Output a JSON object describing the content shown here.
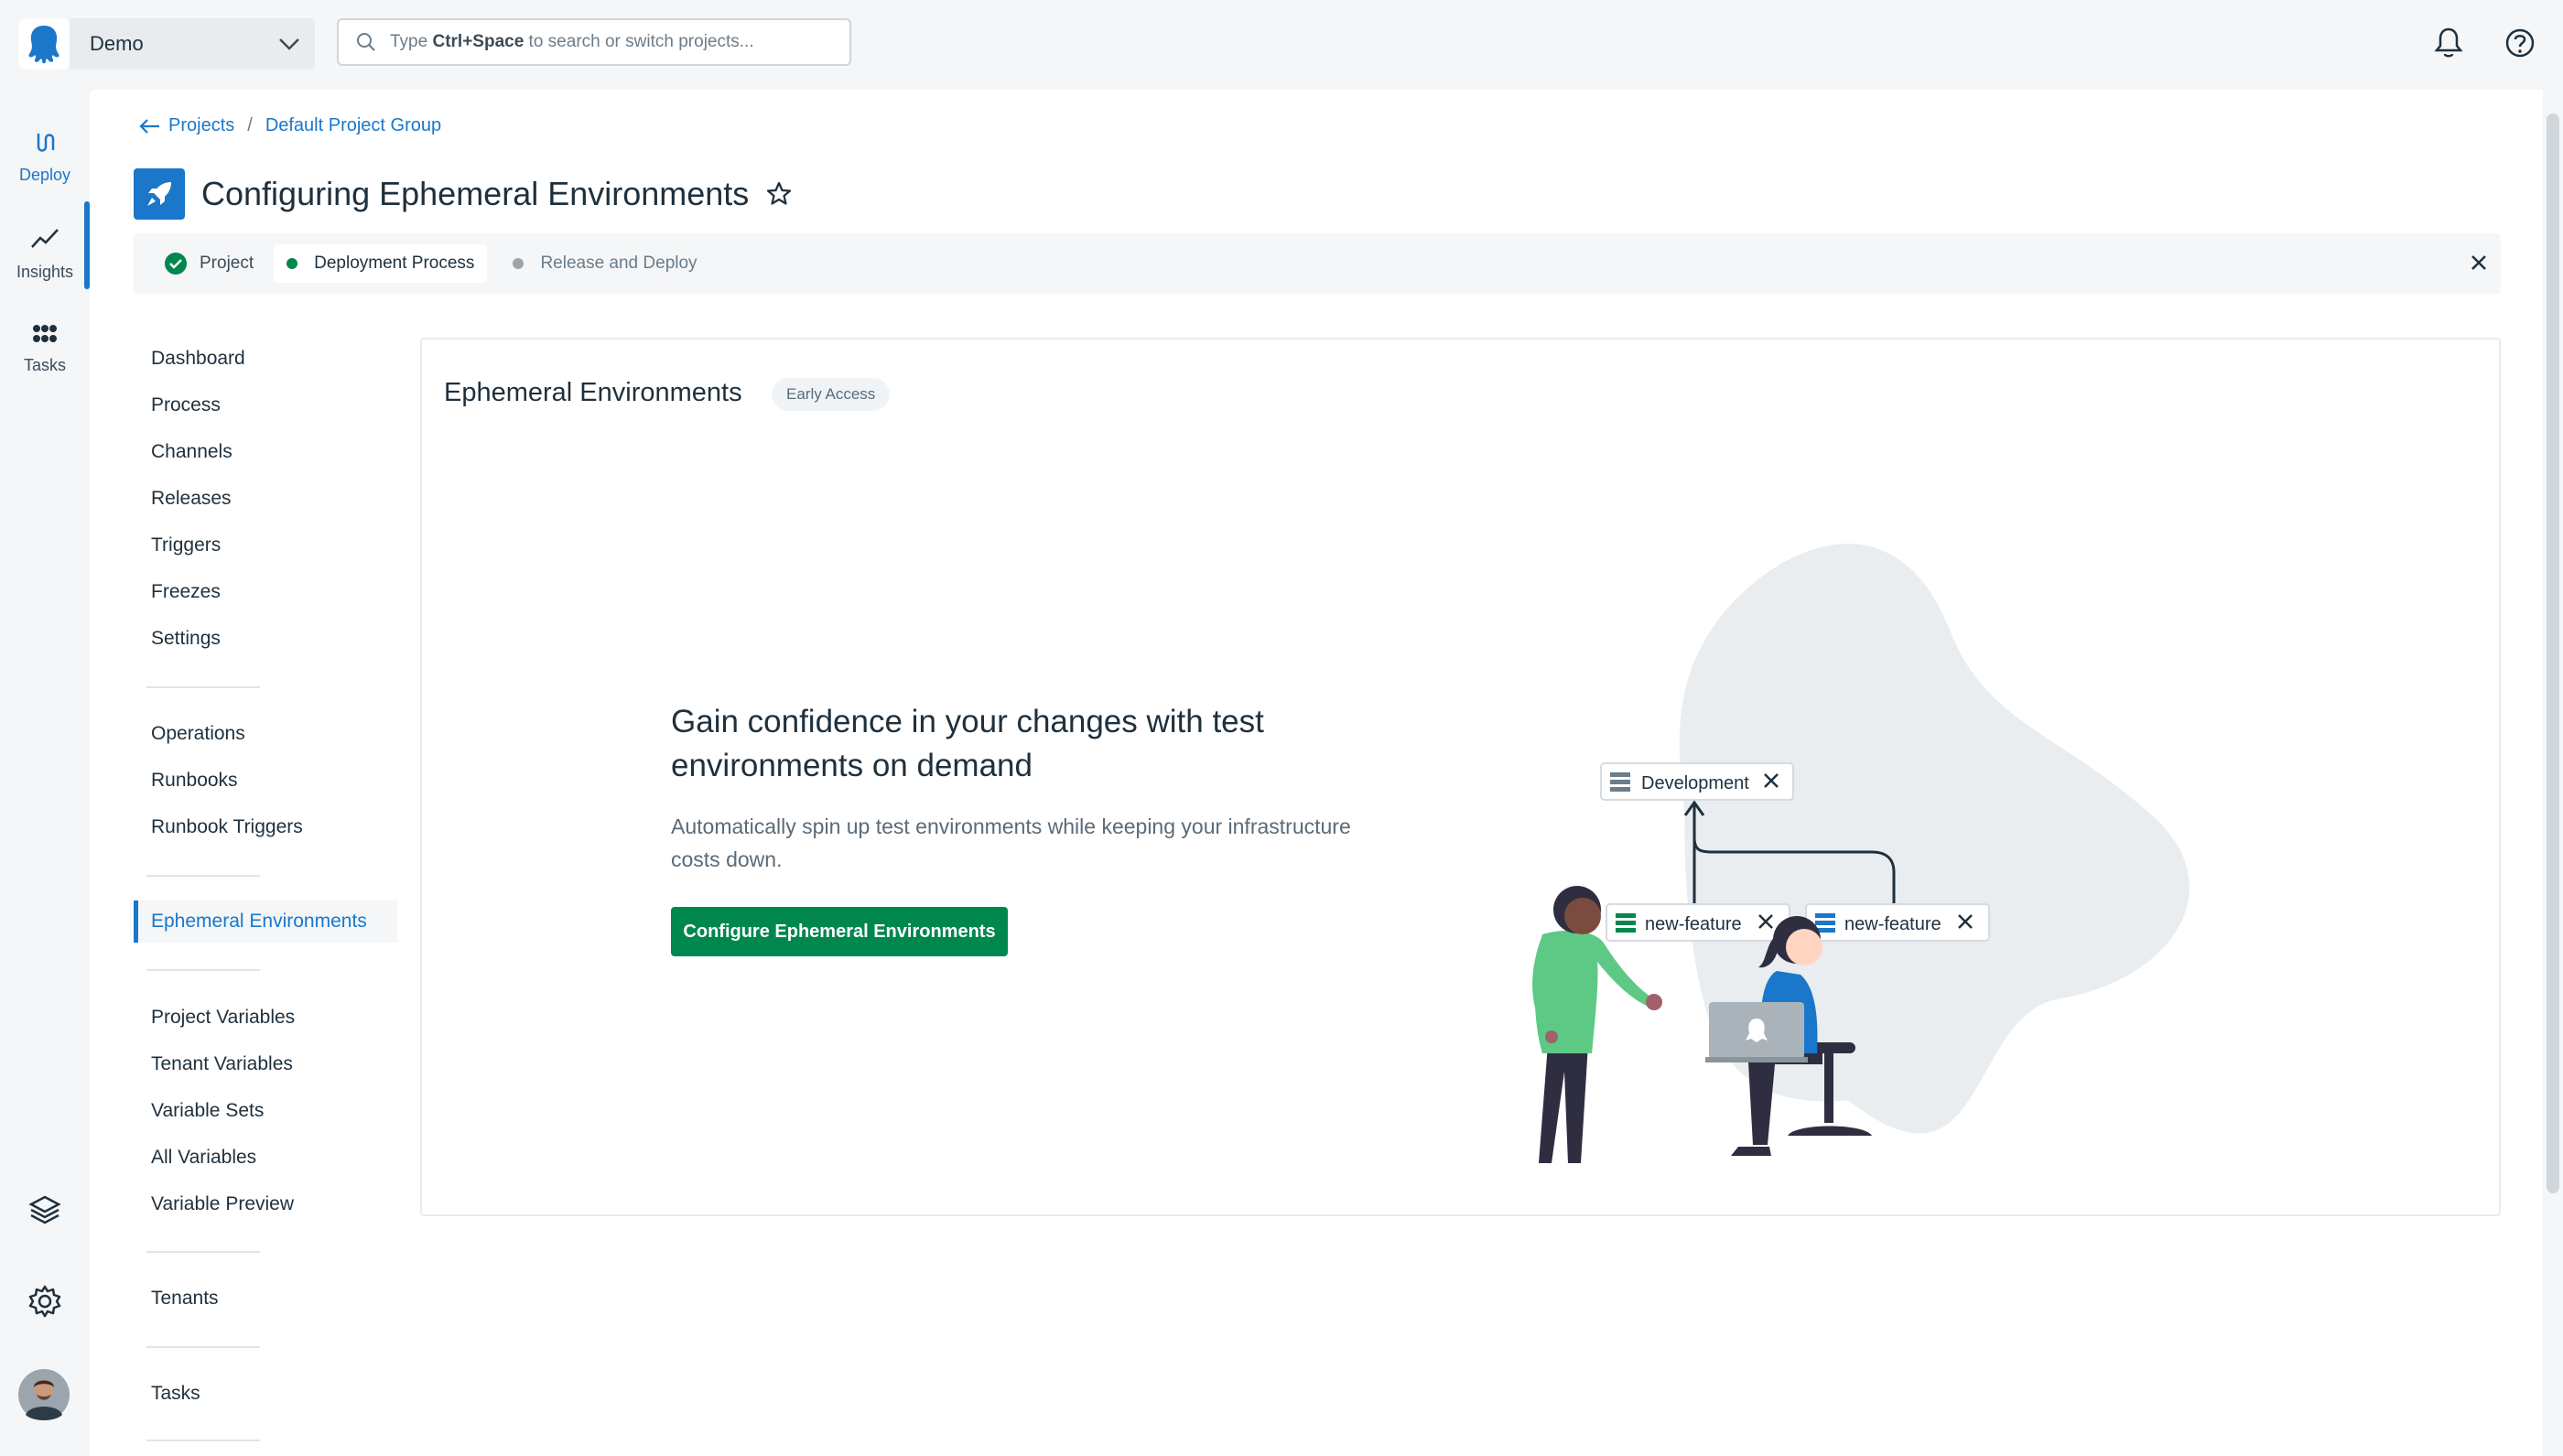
{
  "header": {
    "space_name": "Demo",
    "search_prefix": "Type ",
    "search_shortcut": "Ctrl+Space",
    "search_suffix": " to search or switch projects..."
  },
  "rail": {
    "items": [
      {
        "label": "Deploy",
        "icon": "deploy-icon"
      },
      {
        "label": "Insights",
        "icon": "insights-icon"
      },
      {
        "label": "Tasks",
        "icon": "tasks-icon"
      }
    ]
  },
  "breadcrumb": {
    "projects": "Projects",
    "separator": "/",
    "group": "Default Project Group"
  },
  "page": {
    "title": "Configuring Ephemeral Environments"
  },
  "steps": [
    {
      "label": "Project",
      "status": "complete"
    },
    {
      "label": "Deployment Process",
      "status": "current"
    },
    {
      "label": "Release and Deploy",
      "status": "pending"
    }
  ],
  "nav": {
    "dashboard": "Dashboard",
    "process": "Process",
    "channels": "Channels",
    "releases": "Releases",
    "triggers": "Triggers",
    "freezes": "Freezes",
    "settings": "Settings",
    "operations": "Operations",
    "runbooks": "Runbooks",
    "runbook_triggers": "Runbook Triggers",
    "ephemeral": "Ephemeral Environments",
    "project_variables": "Project Variables",
    "tenant_variables": "Tenant Variables",
    "variable_sets": "Variable Sets",
    "all_variables": "All Variables",
    "variable_preview": "Variable Preview",
    "tenants": "Tenants",
    "tasks": "Tasks"
  },
  "panel": {
    "title": "Ephemeral Environments",
    "badge": "Early Access",
    "headline": "Gain confidence in your changes with test environments on demand",
    "description": "Automatically spin up test environments while keeping your infrastructure costs down.",
    "cta": "Configure Ephemeral Environments"
  },
  "illustration": {
    "chip_top": "Development",
    "chip_left": "new-feature",
    "chip_right": "new-feature"
  },
  "colors": {
    "accent": "#1a77ca",
    "success": "#00874d",
    "background": "#f4f6f8"
  }
}
